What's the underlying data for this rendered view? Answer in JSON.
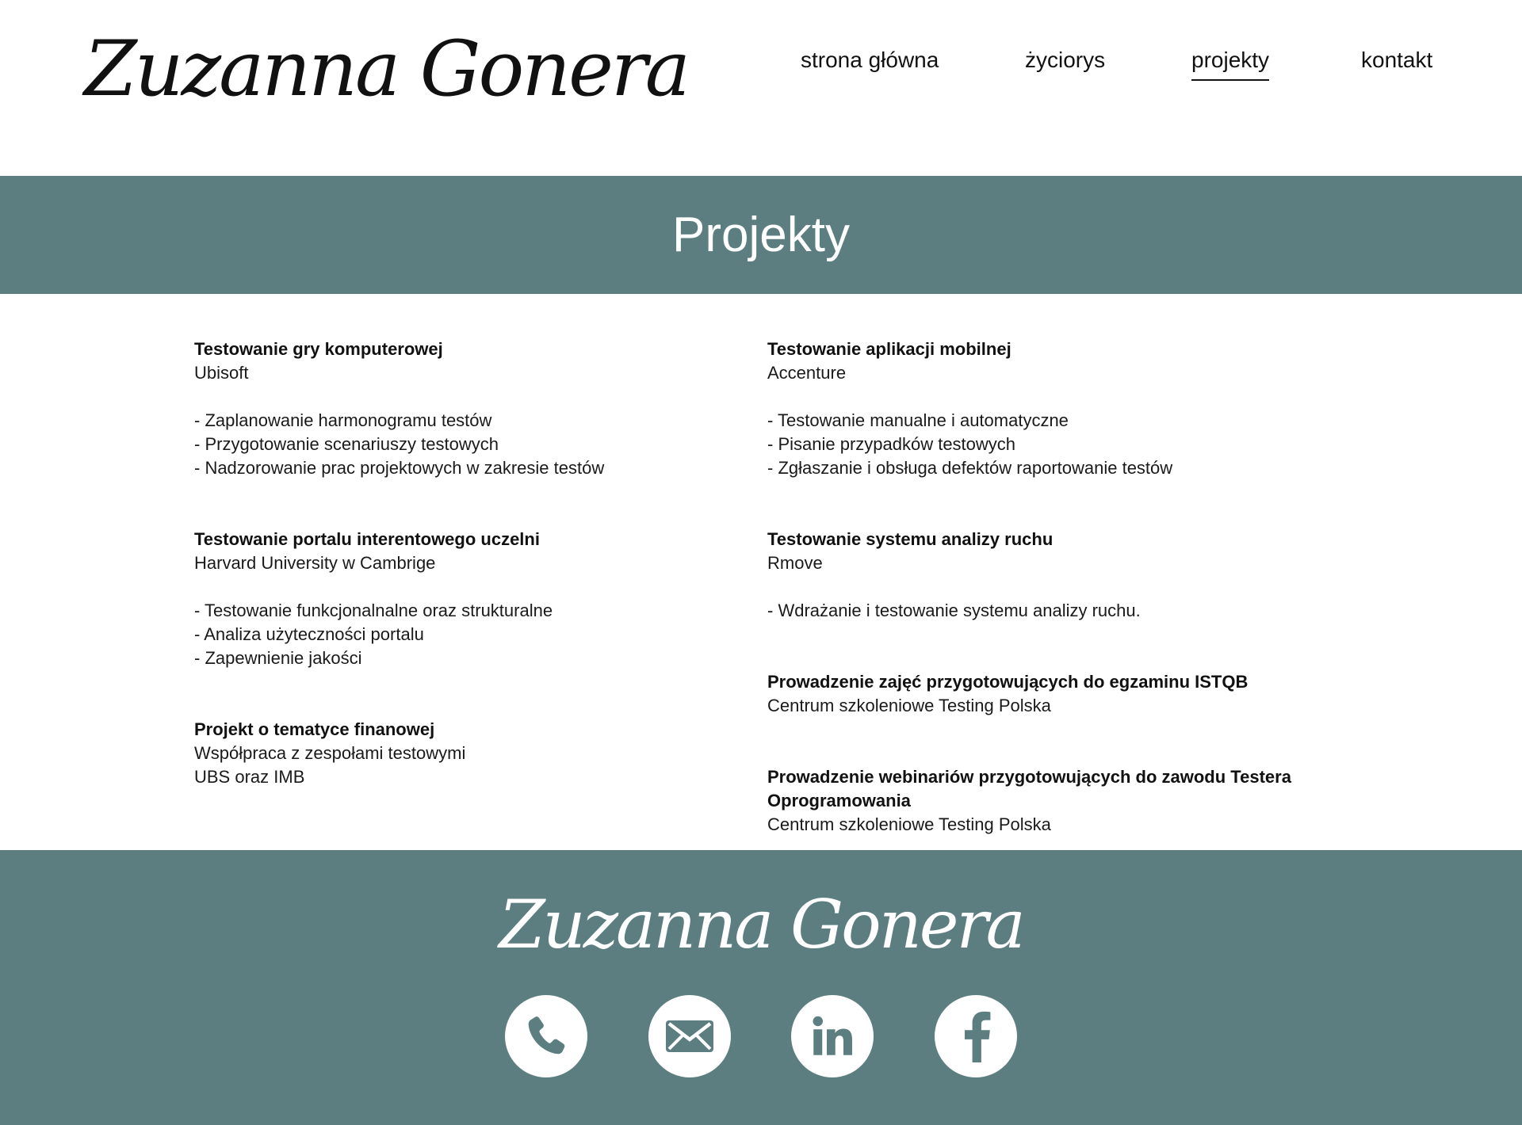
{
  "header": {
    "logo": "Zuzanna Gonera",
    "nav": [
      {
        "label": "strona główna",
        "active": false
      },
      {
        "label": "życiorys",
        "active": false
      },
      {
        "label": "projekty",
        "active": true
      },
      {
        "label": "kontakt",
        "active": false
      }
    ]
  },
  "banner": {
    "title": "Projekty"
  },
  "projects": {
    "left": [
      {
        "title": "Testowanie gry komputerowej",
        "company": "Ubisoft",
        "tasks": [
          "- Zaplanowanie harmonogramu testów",
          "- Przygotowanie scenariuszy testowych",
          "- Nadzorowanie prac projektowych w zakresie testów"
        ]
      },
      {
        "title": "Testowanie portalu interentowego uczelni",
        "company": "Harvard University w Cambrige",
        "tasks": [
          "- Testowanie funkcjonalnalne oraz strukturalne",
          "- Analiza użyteczności portalu",
          "- Zapewnienie jakości"
        ]
      },
      {
        "title": "Projekt o tematyce finanowej",
        "company": "Współpraca z zespołami testowymi",
        "company2": "UBS oraz IMB"
      }
    ],
    "right": [
      {
        "title": "Testowanie aplikacji mobilnej",
        "company": "Accenture",
        "tasks": [
          "- Testowanie manualne i automatyczne",
          "- Pisanie przypadków testowych",
          "- Zgłaszanie i obsługa defektów raportowanie testów"
        ]
      },
      {
        "title": "Testowanie systemu analizy ruchu",
        "company": "Rmove",
        "tasks": [
          "- Wdrażanie i testowanie systemu analizy ruchu."
        ]
      },
      {
        "title": "Prowadzenie zajęć przygotowujących do egzaminu ISTQB",
        "company": "Centrum szkoleniowe Testing Polska"
      },
      {
        "title": "Prowadzenie webinariów przygotowujących do zawodu Testera Oprogramowania",
        "company": "Centrum szkoleniowe Testing Polska"
      }
    ]
  },
  "footer": {
    "logo": "Zuzanna Gonera",
    "social_icons": [
      "phone-icon",
      "mail-icon",
      "linkedin-icon",
      "facebook-icon"
    ]
  },
  "colors": {
    "accent": "#5d7e81",
    "text": "#111111",
    "background": "#ffffff"
  }
}
